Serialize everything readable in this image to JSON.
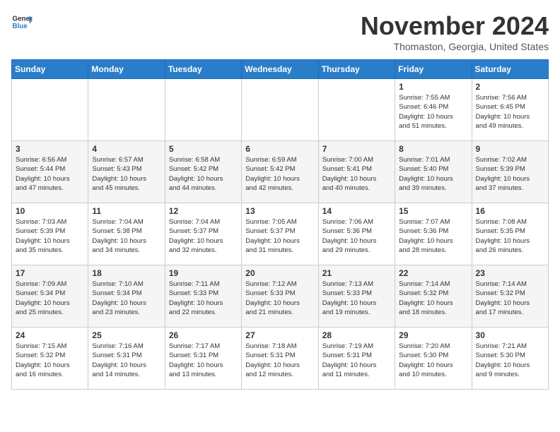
{
  "logo": {
    "line1": "General",
    "line2": "Blue"
  },
  "title": "November 2024",
  "location": "Thomaston, Georgia, United States",
  "weekdays": [
    "Sunday",
    "Monday",
    "Tuesday",
    "Wednesday",
    "Thursday",
    "Friday",
    "Saturday"
  ],
  "weeks": [
    [
      {
        "day": "",
        "info": ""
      },
      {
        "day": "",
        "info": ""
      },
      {
        "day": "",
        "info": ""
      },
      {
        "day": "",
        "info": ""
      },
      {
        "day": "",
        "info": ""
      },
      {
        "day": "1",
        "info": "Sunrise: 7:55 AM\nSunset: 6:46 PM\nDaylight: 10 hours\nand 51 minutes."
      },
      {
        "day": "2",
        "info": "Sunrise: 7:56 AM\nSunset: 6:45 PM\nDaylight: 10 hours\nand 49 minutes."
      }
    ],
    [
      {
        "day": "3",
        "info": "Sunrise: 6:56 AM\nSunset: 5:44 PM\nDaylight: 10 hours\nand 47 minutes."
      },
      {
        "day": "4",
        "info": "Sunrise: 6:57 AM\nSunset: 5:43 PM\nDaylight: 10 hours\nand 45 minutes."
      },
      {
        "day": "5",
        "info": "Sunrise: 6:58 AM\nSunset: 5:42 PM\nDaylight: 10 hours\nand 44 minutes."
      },
      {
        "day": "6",
        "info": "Sunrise: 6:59 AM\nSunset: 5:42 PM\nDaylight: 10 hours\nand 42 minutes."
      },
      {
        "day": "7",
        "info": "Sunrise: 7:00 AM\nSunset: 5:41 PM\nDaylight: 10 hours\nand 40 minutes."
      },
      {
        "day": "8",
        "info": "Sunrise: 7:01 AM\nSunset: 5:40 PM\nDaylight: 10 hours\nand 39 minutes."
      },
      {
        "day": "9",
        "info": "Sunrise: 7:02 AM\nSunset: 5:39 PM\nDaylight: 10 hours\nand 37 minutes."
      }
    ],
    [
      {
        "day": "10",
        "info": "Sunrise: 7:03 AM\nSunset: 5:39 PM\nDaylight: 10 hours\nand 35 minutes."
      },
      {
        "day": "11",
        "info": "Sunrise: 7:04 AM\nSunset: 5:38 PM\nDaylight: 10 hours\nand 34 minutes."
      },
      {
        "day": "12",
        "info": "Sunrise: 7:04 AM\nSunset: 5:37 PM\nDaylight: 10 hours\nand 32 minutes."
      },
      {
        "day": "13",
        "info": "Sunrise: 7:05 AM\nSunset: 5:37 PM\nDaylight: 10 hours\nand 31 minutes."
      },
      {
        "day": "14",
        "info": "Sunrise: 7:06 AM\nSunset: 5:36 PM\nDaylight: 10 hours\nand 29 minutes."
      },
      {
        "day": "15",
        "info": "Sunrise: 7:07 AM\nSunset: 5:36 PM\nDaylight: 10 hours\nand 28 minutes."
      },
      {
        "day": "16",
        "info": "Sunrise: 7:08 AM\nSunset: 5:35 PM\nDaylight: 10 hours\nand 26 minutes."
      }
    ],
    [
      {
        "day": "17",
        "info": "Sunrise: 7:09 AM\nSunset: 5:34 PM\nDaylight: 10 hours\nand 25 minutes."
      },
      {
        "day": "18",
        "info": "Sunrise: 7:10 AM\nSunset: 5:34 PM\nDaylight: 10 hours\nand 23 minutes."
      },
      {
        "day": "19",
        "info": "Sunrise: 7:11 AM\nSunset: 5:33 PM\nDaylight: 10 hours\nand 22 minutes."
      },
      {
        "day": "20",
        "info": "Sunrise: 7:12 AM\nSunset: 5:33 PM\nDaylight: 10 hours\nand 21 minutes."
      },
      {
        "day": "21",
        "info": "Sunrise: 7:13 AM\nSunset: 5:33 PM\nDaylight: 10 hours\nand 19 minutes."
      },
      {
        "day": "22",
        "info": "Sunrise: 7:14 AM\nSunset: 5:32 PM\nDaylight: 10 hours\nand 18 minutes."
      },
      {
        "day": "23",
        "info": "Sunrise: 7:14 AM\nSunset: 5:32 PM\nDaylight: 10 hours\nand 17 minutes."
      }
    ],
    [
      {
        "day": "24",
        "info": "Sunrise: 7:15 AM\nSunset: 5:32 PM\nDaylight: 10 hours\nand 16 minutes."
      },
      {
        "day": "25",
        "info": "Sunrise: 7:16 AM\nSunset: 5:31 PM\nDaylight: 10 hours\nand 14 minutes."
      },
      {
        "day": "26",
        "info": "Sunrise: 7:17 AM\nSunset: 5:31 PM\nDaylight: 10 hours\nand 13 minutes."
      },
      {
        "day": "27",
        "info": "Sunrise: 7:18 AM\nSunset: 5:31 PM\nDaylight: 10 hours\nand 12 minutes."
      },
      {
        "day": "28",
        "info": "Sunrise: 7:19 AM\nSunset: 5:31 PM\nDaylight: 10 hours\nand 11 minutes."
      },
      {
        "day": "29",
        "info": "Sunrise: 7:20 AM\nSunset: 5:30 PM\nDaylight: 10 hours\nand 10 minutes."
      },
      {
        "day": "30",
        "info": "Sunrise: 7:21 AM\nSunset: 5:30 PM\nDaylight: 10 hours\nand 9 minutes."
      }
    ]
  ]
}
